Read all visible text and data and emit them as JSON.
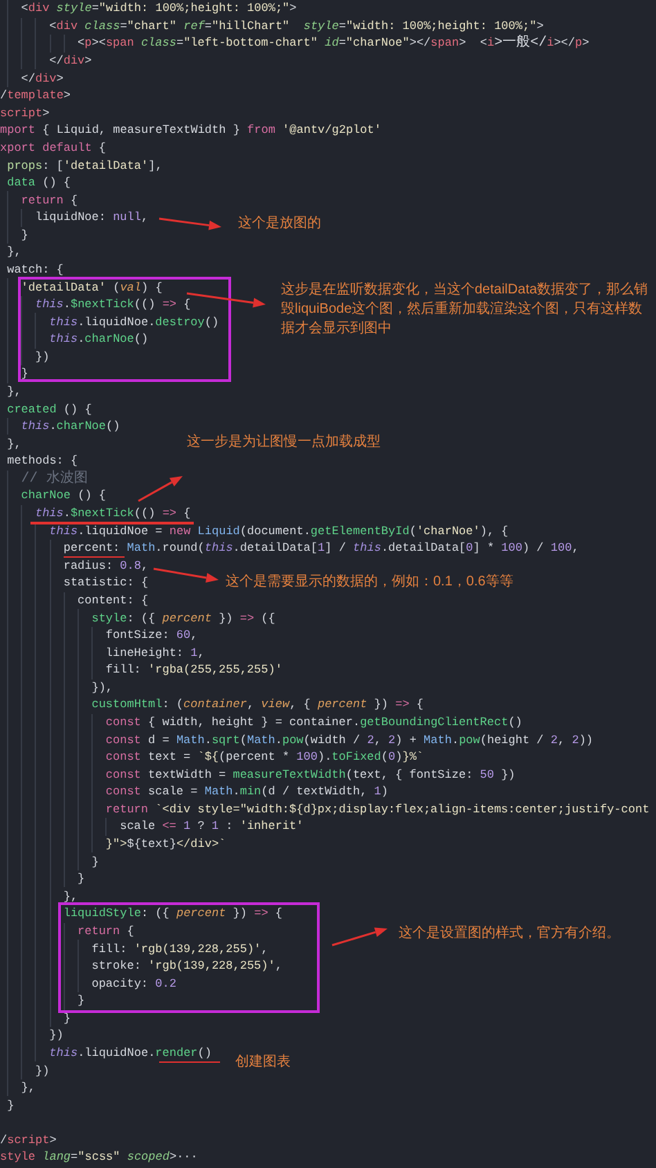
{
  "code_lines": [
    {
      "tokens": [
        {
          "text": "   <",
          "kind": "plain"
        },
        {
          "text": "div",
          "kind": "tag"
        },
        {
          "text": " style",
          "kind": "attr"
        },
        {
          "text": "=",
          "kind": "plain"
        },
        {
          "text": "\"width: 100%;height: 100%;\"",
          "kind": "string"
        },
        {
          "text": ">",
          "kind": "plain"
        }
      ]
    },
    {
      "tokens": [
        {
          "text": "       <",
          "kind": "plain"
        },
        {
          "text": "div",
          "kind": "tag"
        },
        {
          "text": " class",
          "kind": "attr"
        },
        {
          "text": "=",
          "kind": "plain"
        },
        {
          "text": "\"chart\"",
          "kind": "string"
        },
        {
          "text": " ref",
          "kind": "attr"
        },
        {
          "text": "=",
          "kind": "plain"
        },
        {
          "text": "\"hillChart\"",
          "kind": "string"
        },
        {
          "text": "  style",
          "kind": "attr"
        },
        {
          "text": "=",
          "kind": "plain"
        },
        {
          "text": "\"width: 100%;height: 100%;\"",
          "kind": "string"
        },
        {
          "text": ">",
          "kind": "plain"
        }
      ]
    },
    {
      "tokens": [
        {
          "text": "           <",
          "kind": "plain"
        },
        {
          "text": "p",
          "kind": "tag"
        },
        {
          "text": "><",
          "kind": "plain"
        },
        {
          "text": "span",
          "kind": "tag"
        },
        {
          "text": " class",
          "kind": "attr"
        },
        {
          "text": "=",
          "kind": "plain"
        },
        {
          "text": "\"left-bottom-chart\"",
          "kind": "string"
        },
        {
          "text": " id",
          "kind": "attr"
        },
        {
          "text": "=",
          "kind": "plain"
        },
        {
          "text": "\"charNoe\"",
          "kind": "string"
        },
        {
          "text": "></",
          "kind": "plain"
        },
        {
          "text": "span",
          "kind": "tag"
        },
        {
          "text": ">  <",
          "kind": "plain"
        },
        {
          "text": "i",
          "kind": "tag"
        },
        {
          "text": ">一般</",
          "kind": "plain"
        },
        {
          "text": "i",
          "kind": "tag"
        },
        {
          "text": "></",
          "kind": "plain"
        },
        {
          "text": "p",
          "kind": "tag"
        },
        {
          "text": ">",
          "kind": "plain"
        }
      ]
    },
    {
      "tokens": [
        {
          "text": "       </",
          "kind": "plain"
        },
        {
          "text": "div",
          "kind": "tag"
        },
        {
          "text": ">",
          "kind": "plain"
        }
      ]
    },
    {
      "tokens": [
        {
          "text": "   </",
          "kind": "plain"
        },
        {
          "text": "div",
          "kind": "tag"
        },
        {
          "text": ">",
          "kind": "plain"
        }
      ]
    },
    {
      "tokens": [
        {
          "text": "/",
          "kind": "plain"
        },
        {
          "text": "template",
          "kind": "tag"
        },
        {
          "text": ">",
          "kind": "plain"
        }
      ]
    },
    {
      "tokens": [
        {
          "text": "script",
          "kind": "tag"
        },
        {
          "text": ">",
          "kind": "plain"
        }
      ]
    },
    {
      "tokens": [
        {
          "text": "mport",
          "kind": "keyword"
        },
        {
          "text": " { Liquid, measureTextWidth } ",
          "kind": "plain"
        },
        {
          "text": "from",
          "kind": "keyword"
        },
        {
          "text": " '@antv/g2plot'",
          "kind": "string"
        }
      ]
    },
    {
      "tokens": [
        {
          "text": "xport default",
          "kind": "keyword"
        },
        {
          "text": " {",
          "kind": "plain"
        }
      ]
    },
    {
      "tokens": [
        {
          "text": " props",
          "kind": "key"
        },
        {
          "text": ": [",
          "kind": "plain"
        },
        {
          "text": "'detailData'",
          "kind": "string"
        },
        {
          "text": "],",
          "kind": "plain"
        }
      ]
    },
    {
      "tokens": [
        {
          "text": " data",
          "kind": "function"
        },
        {
          "text": " () {",
          "kind": "plain"
        }
      ]
    },
    {
      "tokens": [
        {
          "text": "   return",
          "kind": "keyword"
        },
        {
          "text": " {",
          "kind": "plain"
        }
      ]
    },
    {
      "tokens": [
        {
          "text": "     liquidNoe: ",
          "kind": "plain"
        },
        {
          "text": "null",
          "kind": "number"
        },
        {
          "text": ",",
          "kind": "plain"
        }
      ]
    },
    {
      "tokens": [
        {
          "text": "   }",
          "kind": "plain"
        }
      ]
    },
    {
      "tokens": [
        {
          "text": " },",
          "kind": "plain"
        }
      ]
    },
    {
      "tokens": [
        {
          "text": " watch: {",
          "kind": "plain"
        }
      ]
    },
    {
      "tokens": [
        {
          "text": "   'detailData'",
          "kind": "string"
        },
        {
          "text": " (",
          "kind": "plain"
        },
        {
          "text": "val",
          "kind": "parameter"
        },
        {
          "text": ") {",
          "kind": "plain"
        }
      ]
    },
    {
      "tokens": [
        {
          "text": "     this",
          "kind": "self"
        },
        {
          "text": ".",
          "kind": "plain"
        },
        {
          "text": "$nextTick",
          "kind": "function"
        },
        {
          "text": "(() ",
          "kind": "plain"
        },
        {
          "text": "=>",
          "kind": "keyword"
        },
        {
          "text": " {",
          "kind": "plain"
        }
      ]
    },
    {
      "tokens": [
        {
          "text": "       this",
          "kind": "self"
        },
        {
          "text": ".liquidNoe.",
          "kind": "plain"
        },
        {
          "text": "destroy",
          "kind": "function"
        },
        {
          "text": "()",
          "kind": "plain"
        }
      ]
    },
    {
      "tokens": [
        {
          "text": "       this",
          "kind": "self"
        },
        {
          "text": ".",
          "kind": "plain"
        },
        {
          "text": "charNoe",
          "kind": "function"
        },
        {
          "text": "()",
          "kind": "plain"
        }
      ]
    },
    {
      "tokens": [
        {
          "text": "     })",
          "kind": "plain"
        }
      ]
    },
    {
      "tokens": [
        {
          "text": "   }",
          "kind": "plain"
        }
      ]
    },
    {
      "tokens": [
        {
          "text": " },",
          "kind": "plain"
        }
      ]
    },
    {
      "tokens": [
        {
          "text": " created",
          "kind": "function"
        },
        {
          "text": " () {",
          "kind": "plain"
        }
      ]
    },
    {
      "tokens": [
        {
          "text": "   this",
          "kind": "self"
        },
        {
          "text": ".",
          "kind": "plain"
        },
        {
          "text": "charNoe",
          "kind": "function"
        },
        {
          "text": "()",
          "kind": "plain"
        }
      ]
    },
    {
      "tokens": [
        {
          "text": " },",
          "kind": "plain"
        }
      ]
    },
    {
      "tokens": [
        {
          "text": " methods: {",
          "kind": "plain"
        }
      ]
    },
    {
      "tokens": [
        {
          "text": "   // 水波图",
          "kind": "comment"
        }
      ]
    },
    {
      "tokens": [
        {
          "text": "   charNoe",
          "kind": "function"
        },
        {
          "text": " () {",
          "kind": "plain"
        }
      ]
    },
    {
      "tokens": [
        {
          "text": "     this",
          "kind": "self"
        },
        {
          "text": ".",
          "kind": "plain"
        },
        {
          "text": "$nextTick",
          "kind": "function"
        },
        {
          "text": "(() ",
          "kind": "plain"
        },
        {
          "text": "=>",
          "kind": "keyword"
        },
        {
          "text": " {",
          "kind": "plain"
        }
      ]
    },
    {
      "tokens": [
        {
          "text": "       this",
          "kind": "self"
        },
        {
          "text": ".liquidNoe = ",
          "kind": "plain"
        },
        {
          "text": "new",
          "kind": "keyword"
        },
        {
          "text": " Liquid",
          "kind": "class"
        },
        {
          "text": "(document.",
          "kind": "plain"
        },
        {
          "text": "getElementById",
          "kind": "function"
        },
        {
          "text": "(",
          "kind": "plain"
        },
        {
          "text": "'charNoe'",
          "kind": "string"
        },
        {
          "text": "), {",
          "kind": "plain"
        }
      ]
    },
    {
      "tokens": [
        {
          "text": "         percent: ",
          "kind": "plain"
        },
        {
          "text": "Math",
          "kind": "class"
        },
        {
          "text": ".round(",
          "kind": "plain"
        },
        {
          "text": "this",
          "kind": "self"
        },
        {
          "text": ".detailData[",
          "kind": "plain"
        },
        {
          "text": "1",
          "kind": "number"
        },
        {
          "text": "] / ",
          "kind": "plain"
        },
        {
          "text": "this",
          "kind": "self"
        },
        {
          "text": ".detailData[",
          "kind": "plain"
        },
        {
          "text": "0",
          "kind": "number"
        },
        {
          "text": "] * ",
          "kind": "plain"
        },
        {
          "text": "100",
          "kind": "number"
        },
        {
          "text": ") / ",
          "kind": "plain"
        },
        {
          "text": "100",
          "kind": "number"
        },
        {
          "text": ",",
          "kind": "plain"
        }
      ]
    },
    {
      "tokens": [
        {
          "text": "         radius: ",
          "kind": "plain"
        },
        {
          "text": "0.8",
          "kind": "number"
        },
        {
          "text": ",",
          "kind": "plain"
        }
      ]
    },
    {
      "tokens": [
        {
          "text": "         statistic: {",
          "kind": "plain"
        }
      ]
    },
    {
      "tokens": [
        {
          "text": "           content: {",
          "kind": "plain"
        }
      ]
    },
    {
      "tokens": [
        {
          "text": "             style",
          "kind": "function"
        },
        {
          "text": ": ({ ",
          "kind": "plain"
        },
        {
          "text": "percent",
          "kind": "parameter"
        },
        {
          "text": " }) ",
          "kind": "plain"
        },
        {
          "text": "=>",
          "kind": "keyword"
        },
        {
          "text": " ({",
          "kind": "plain"
        }
      ]
    },
    {
      "tokens": [
        {
          "text": "               fontSize: ",
          "kind": "plain"
        },
        {
          "text": "60",
          "kind": "number"
        },
        {
          "text": ",",
          "kind": "plain"
        }
      ]
    },
    {
      "tokens": [
        {
          "text": "               lineHeight: ",
          "kind": "plain"
        },
        {
          "text": "1",
          "kind": "number"
        },
        {
          "text": ",",
          "kind": "plain"
        }
      ]
    },
    {
      "tokens": [
        {
          "text": "               fill: ",
          "kind": "plain"
        },
        {
          "text": "'rgba(255,255,255)'",
          "kind": "string"
        }
      ]
    },
    {
      "tokens": [
        {
          "text": "             }),",
          "kind": "plain"
        }
      ]
    },
    {
      "tokens": [
        {
          "text": "             customHtml",
          "kind": "function"
        },
        {
          "text": ": (",
          "kind": "plain"
        },
        {
          "text": "container",
          "kind": "parameter"
        },
        {
          "text": ", ",
          "kind": "plain"
        },
        {
          "text": "view",
          "kind": "parameter"
        },
        {
          "text": ", { ",
          "kind": "plain"
        },
        {
          "text": "percent",
          "kind": "parameter"
        },
        {
          "text": " }) ",
          "kind": "plain"
        },
        {
          "text": "=>",
          "kind": "keyword"
        },
        {
          "text": " {",
          "kind": "plain"
        }
      ]
    },
    {
      "tokens": [
        {
          "text": "               const",
          "kind": "keyword"
        },
        {
          "text": " { width, height } = container.",
          "kind": "plain"
        },
        {
          "text": "getBoundingClientRect",
          "kind": "function"
        },
        {
          "text": "()",
          "kind": "plain"
        }
      ]
    },
    {
      "tokens": [
        {
          "text": "               const",
          "kind": "keyword"
        },
        {
          "text": " d = ",
          "kind": "plain"
        },
        {
          "text": "Math",
          "kind": "class"
        },
        {
          "text": ".",
          "kind": "plain"
        },
        {
          "text": "sqrt",
          "kind": "function"
        },
        {
          "text": "(",
          "kind": "plain"
        },
        {
          "text": "Math",
          "kind": "class"
        },
        {
          "text": ".",
          "kind": "plain"
        },
        {
          "text": "pow",
          "kind": "function"
        },
        {
          "text": "(width / ",
          "kind": "plain"
        },
        {
          "text": "2",
          "kind": "number"
        },
        {
          "text": ", ",
          "kind": "plain"
        },
        {
          "text": "2",
          "kind": "number"
        },
        {
          "text": ") + ",
          "kind": "plain"
        },
        {
          "text": "Math",
          "kind": "class"
        },
        {
          "text": ".",
          "kind": "plain"
        },
        {
          "text": "pow",
          "kind": "function"
        },
        {
          "text": "(height / ",
          "kind": "plain"
        },
        {
          "text": "2",
          "kind": "number"
        },
        {
          "text": ", ",
          "kind": "plain"
        },
        {
          "text": "2",
          "kind": "number"
        },
        {
          "text": "))",
          "kind": "plain"
        }
      ]
    },
    {
      "tokens": [
        {
          "text": "               const",
          "kind": "keyword"
        },
        {
          "text": " text = ",
          "kind": "plain"
        },
        {
          "text": "`${",
          "kind": "string"
        },
        {
          "text": "(percent * ",
          "kind": "plain"
        },
        {
          "text": "100",
          "kind": "number"
        },
        {
          "text": ").",
          "kind": "plain"
        },
        {
          "text": "toFixed",
          "kind": "function"
        },
        {
          "text": "(",
          "kind": "plain"
        },
        {
          "text": "0",
          "kind": "number"
        },
        {
          "text": ")",
          "kind": "plain"
        },
        {
          "text": "}%`",
          "kind": "string"
        }
      ]
    },
    {
      "tokens": [
        {
          "text": "               const",
          "kind": "keyword"
        },
        {
          "text": " textWidth = ",
          "kind": "plain"
        },
        {
          "text": "measureTextWidth",
          "kind": "function"
        },
        {
          "text": "(text, { fontSize: ",
          "kind": "plain"
        },
        {
          "text": "50",
          "kind": "number"
        },
        {
          "text": " })",
          "kind": "plain"
        }
      ]
    },
    {
      "tokens": [
        {
          "text": "               const",
          "kind": "keyword"
        },
        {
          "text": " scale = ",
          "kind": "plain"
        },
        {
          "text": "Math",
          "kind": "class"
        },
        {
          "text": ".",
          "kind": "plain"
        },
        {
          "text": "min",
          "kind": "function"
        },
        {
          "text": "(d / textWidth, ",
          "kind": "plain"
        },
        {
          "text": "1",
          "kind": "number"
        },
        {
          "text": ")",
          "kind": "plain"
        }
      ]
    },
    {
      "tokens": [
        {
          "text": "               return",
          "kind": "keyword"
        },
        {
          "text": " `<div style=\"width:${d}px;display:flex;align-items:center;justify-cont",
          "kind": "string"
        }
      ]
    },
    {
      "tokens": [
        {
          "text": "                 scale ",
          "kind": "plain"
        },
        {
          "text": "<=",
          "kind": "keyword"
        },
        {
          "text": " 1",
          "kind": "number"
        },
        {
          "text": " ? ",
          "kind": "plain"
        },
        {
          "text": "1",
          "kind": "number"
        },
        {
          "text": " : ",
          "kind": "plain"
        },
        {
          "text": "'inherit'",
          "kind": "string"
        }
      ]
    },
    {
      "tokens": [
        {
          "text": "               }\">",
          "kind": "string"
        },
        {
          "text": "${text}",
          "kind": "plain"
        },
        {
          "text": "</div>`",
          "kind": "string"
        }
      ]
    },
    {
      "tokens": [
        {
          "text": "             }",
          "kind": "plain"
        }
      ]
    },
    {
      "tokens": [
        {
          "text": "           }",
          "kind": "plain"
        }
      ]
    },
    {
      "tokens": [
        {
          "text": "         },",
          "kind": "plain"
        }
      ]
    },
    {
      "tokens": [
        {
          "text": "         liquidStyle",
          "kind": "function"
        },
        {
          "text": ": ({ ",
          "kind": "plain"
        },
        {
          "text": "percent",
          "kind": "parameter"
        },
        {
          "text": " }) ",
          "kind": "plain"
        },
        {
          "text": "=>",
          "kind": "keyword"
        },
        {
          "text": " {",
          "kind": "plain"
        }
      ]
    },
    {
      "tokens": [
        {
          "text": "           return",
          "kind": "keyword"
        },
        {
          "text": " {",
          "kind": "plain"
        }
      ]
    },
    {
      "tokens": [
        {
          "text": "             fill: ",
          "kind": "plain"
        },
        {
          "text": "'rgb(139,228,255)'",
          "kind": "string"
        },
        {
          "text": ",",
          "kind": "plain"
        }
      ]
    },
    {
      "tokens": [
        {
          "text": "             stroke: ",
          "kind": "plain"
        },
        {
          "text": "'rgb(139,228,255)'",
          "kind": "string"
        },
        {
          "text": ",",
          "kind": "plain"
        }
      ]
    },
    {
      "tokens": [
        {
          "text": "             opacity: ",
          "kind": "plain"
        },
        {
          "text": "0.2",
          "kind": "number"
        }
      ]
    },
    {
      "tokens": [
        {
          "text": "           }",
          "kind": "plain"
        }
      ]
    },
    {
      "tokens": [
        {
          "text": "         }",
          "kind": "plain"
        }
      ]
    },
    {
      "tokens": [
        {
          "text": "       })",
          "kind": "plain"
        }
      ]
    },
    {
      "tokens": [
        {
          "text": "       this",
          "kind": "self"
        },
        {
          "text": ".liquidNoe.",
          "kind": "plain"
        },
        {
          "text": "render",
          "kind": "function"
        },
        {
          "text": "()",
          "kind": "plain"
        }
      ]
    },
    {
      "tokens": [
        {
          "text": "     })",
          "kind": "plain"
        }
      ]
    },
    {
      "tokens": [
        {
          "text": "   },",
          "kind": "plain"
        }
      ]
    },
    {
      "tokens": [
        {
          "text": " }",
          "kind": "plain"
        }
      ]
    },
    {
      "kind": "blank"
    },
    {
      "tokens": [
        {
          "text": "/",
          "kind": "plain"
        },
        {
          "text": "script",
          "kind": "tag"
        },
        {
          "text": ">",
          "kind": "plain"
        }
      ]
    },
    {
      "tokens": [
        {
          "text": "style",
          "kind": "tag"
        },
        {
          "text": " lang",
          "kind": "attr"
        },
        {
          "text": "=",
          "kind": "plain"
        },
        {
          "text": "\"scss\"",
          "kind": "string"
        },
        {
          "text": " scoped",
          "kind": "attr"
        },
        {
          "text": ">···",
          "kind": "plain"
        }
      ]
    }
  ],
  "annotations": [
    {
      "text": "这个是放图的"
    },
    {
      "text": "这步是在监听数据变化，当这个detailData数据变了，那么销毁liquiBode这个图，然后重新加载渲染这个图，只有这样数据才会显示到图中"
    },
    {
      "text": "这一步是为让图慢一点加载成型"
    },
    {
      "text": "这个是需要显示的数据的，例如：0.1，0.6等等"
    },
    {
      "text": "这个是设置图的样式，官方有介绍。"
    },
    {
      "text": "创建图表"
    }
  ]
}
